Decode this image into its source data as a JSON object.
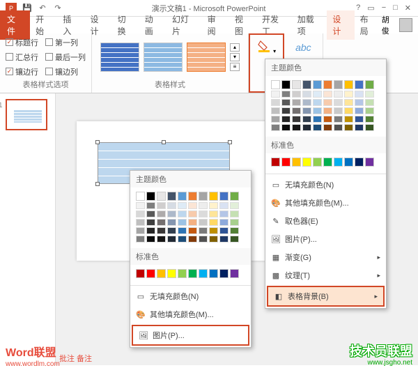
{
  "titlebar": {
    "title": "演示文稿1 - Microsoft PowerPoint"
  },
  "tabs": {
    "file": "文件",
    "items": [
      "开始",
      "插入",
      "设计",
      "切换",
      "动画",
      "幻灯片",
      "审阅",
      "视图",
      "开发工",
      "加载项"
    ],
    "context": [
      "设计",
      "布局"
    ],
    "user": "胡俊"
  },
  "ribbon": {
    "table_options": {
      "header_row": "标题行",
      "first_col": "第一列",
      "total_row": "汇总行",
      "last_col": "最后一列",
      "banded_row": "镶边行",
      "banded_col": "镶边列",
      "label": "表格样式选项"
    },
    "styles_label": "表格样式"
  },
  "dropdown": {
    "theme_colors": "主题颜色",
    "standard_colors": "标准色",
    "no_fill": "无填充颜色(N)",
    "more_fill": "其他填充颜色(M)...",
    "eyedropper": "取色器(E)",
    "picture": "图片(P)...",
    "gradient": "渐变(G)",
    "texture": "纹理(T)",
    "table_bg": "表格背景(B)"
  },
  "theme_palette": {
    "row1": [
      "#ffffff",
      "#000000",
      "#e7e6e6",
      "#44546a",
      "#5b9bd5",
      "#ed7d31",
      "#a5a5a5",
      "#ffc000",
      "#4472c4",
      "#70ad47"
    ],
    "grad": [
      [
        "#f2f2f2",
        "#7f7f7f",
        "#d0cece",
        "#d6dce4",
        "#deebf6",
        "#fbe5d5",
        "#ededed",
        "#fff2cc",
        "#d9e2f3",
        "#e2efd9"
      ],
      [
        "#d8d8d8",
        "#595959",
        "#aeabab",
        "#adb9ca",
        "#bdd7ee",
        "#f7cbac",
        "#dbdbdb",
        "#fee599",
        "#b4c6e7",
        "#c5e0b3"
      ],
      [
        "#bfbfbf",
        "#3f3f3f",
        "#757070",
        "#8496b0",
        "#9cc3e5",
        "#f4b183",
        "#c9c9c9",
        "#ffd965",
        "#8eaadb",
        "#a8d08d"
      ],
      [
        "#a5a5a5",
        "#262626",
        "#3a3838",
        "#323f4f",
        "#2e75b5",
        "#c55a11",
        "#7b7b7b",
        "#bf9000",
        "#2f5496",
        "#538135"
      ],
      [
        "#7f7f7f",
        "#0c0c0c",
        "#171616",
        "#222a35",
        "#1e4e79",
        "#833c0b",
        "#525252",
        "#7f6000",
        "#1f3864",
        "#375623"
      ]
    ],
    "standard": [
      "#c00000",
      "#ff0000",
      "#ffc000",
      "#ffff00",
      "#92d050",
      "#00b050",
      "#00b0f0",
      "#0070c0",
      "#002060",
      "#7030a0"
    ]
  },
  "watermarks": {
    "w1": "Word联盟",
    "w1_url": "www.wordlm.com",
    "w2": "技术员联盟",
    "w2_url": "www.jsgho.net"
  },
  "statusbar": "批注  备注"
}
